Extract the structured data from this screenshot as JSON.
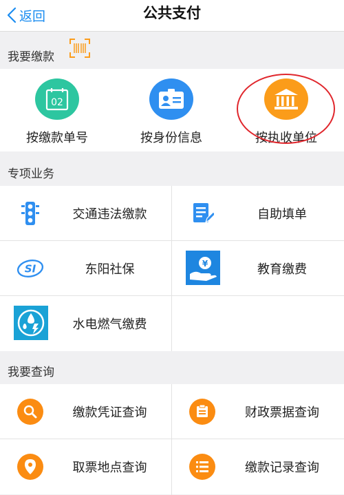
{
  "nav": {
    "back_label": "返回",
    "title": "公共支付"
  },
  "pay_section": {
    "header": "我要缴款",
    "items": [
      {
        "label": "按缴款单号",
        "icon": "payment-number-icon",
        "color": "#2dc6a0",
        "number": "02"
      },
      {
        "label": "按身份信息",
        "icon": "id-card-icon",
        "color": "#2f8ff0"
      },
      {
        "label": "按执收单位",
        "icon": "bank-building-icon",
        "color": "#fb9c1a"
      }
    ]
  },
  "special_section": {
    "header": "专项业务",
    "items": [
      {
        "label": "交通违法缴款",
        "icon": "traffic-light-icon"
      },
      {
        "label": "自助填单",
        "icon": "form-edit-icon"
      },
      {
        "label": "东阳社保",
        "icon": "social-security-icon",
        "logo_text": "SI"
      },
      {
        "label": "教育缴费",
        "icon": "education-fee-icon",
        "symbol": "¥"
      },
      {
        "label": "水电燃气缴费",
        "icon": "water-power-gas-icon"
      }
    ]
  },
  "query_section": {
    "header": "我要查询",
    "items": [
      {
        "label": "缴款凭证查询",
        "icon": "search-icon"
      },
      {
        "label": "财政票据查询",
        "icon": "receipt-icon"
      },
      {
        "label": "取票地点查询",
        "icon": "location-pin-icon"
      },
      {
        "label": "缴款记录查询",
        "icon": "list-icon"
      }
    ]
  },
  "colors": {
    "accent_blue": "#1a8cf0",
    "orange": "#fb8c12",
    "highlight_red": "#e0262c"
  }
}
